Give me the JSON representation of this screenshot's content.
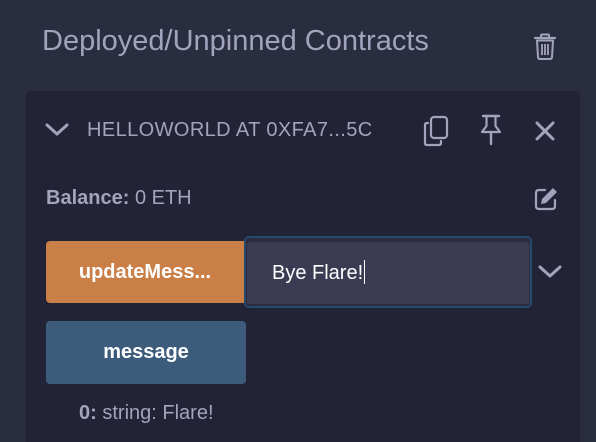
{
  "panel": {
    "title": "Deployed/Unpinned Contracts",
    "icons": {
      "clear": "trash-icon"
    }
  },
  "instance": {
    "title": "HELLOWORLD AT 0XFA7...5C",
    "icons": {
      "expand": "chevron-down-icon",
      "copy": "copy-icon",
      "pin": "pin-icon",
      "close": "close-icon",
      "edit": "edit-icon"
    },
    "balance": {
      "label": "Balance:",
      "value": "0 ETH"
    },
    "functions": [
      {
        "label": "updateMess...",
        "type": "transact",
        "color": "#c97f46",
        "input_value": "Bye Flare!",
        "expand_icon": "chevron-down-icon"
      },
      {
        "label": "message",
        "type": "call",
        "color": "#3d5c7c"
      }
    ],
    "output": {
      "index": "0:",
      "value": "string: Flare!"
    }
  },
  "colors": {
    "background": "#2a2c3f",
    "card": "#222336",
    "text": "#a2a3bd",
    "transact": "#c97f46",
    "call": "#3d5c7c",
    "input_border": "#264a6b"
  }
}
